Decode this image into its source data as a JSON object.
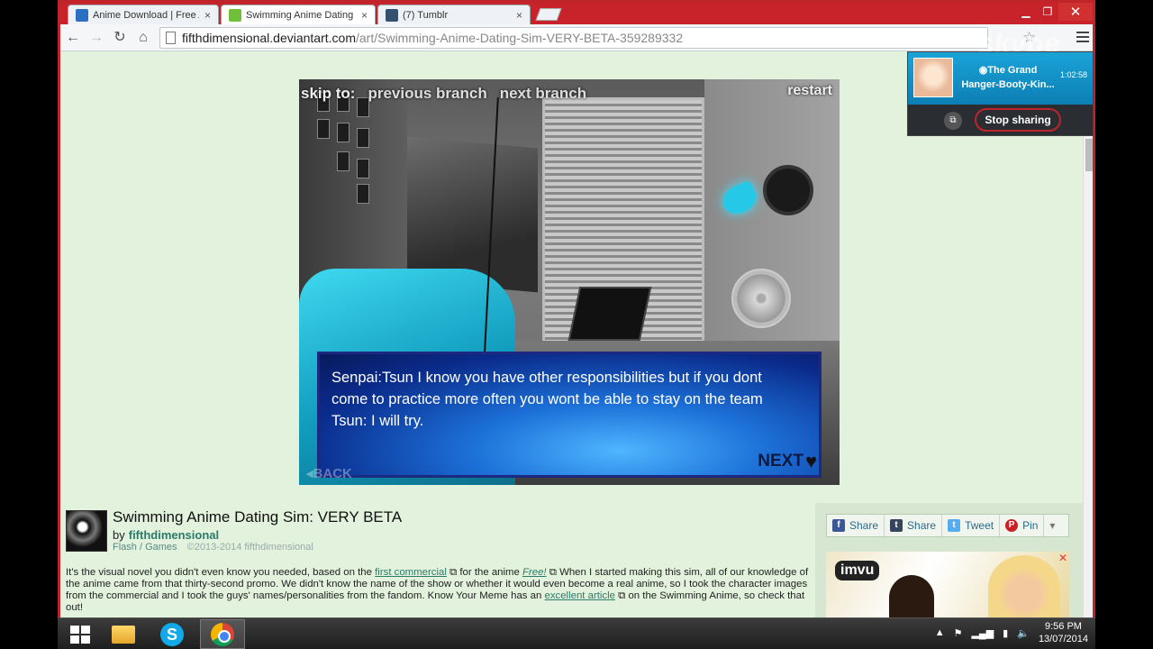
{
  "browser": {
    "tabs": [
      {
        "title": "Anime Download | Free Ar",
        "favicon_color": "#2b6fc2",
        "active": false
      },
      {
        "title": "Swimming Anime Dating",
        "favicon_color": "#6fbf3a",
        "active": true
      },
      {
        "title": "(7) Tumblr",
        "favicon_color": "#34526f",
        "active": false
      }
    ],
    "url_host": "fifthdimensional.deviantart.com",
    "url_path": "/art/Swimming-Anime-Dating-Sim-VERY-BETA-359289332"
  },
  "game": {
    "skip_to": "skip to:",
    "previous_branch": "previous branch",
    "next_branch": "next branch",
    "restart": "restart",
    "dialog_lines": [
      "Senpai:Tsun I know you have other responsibilities but if you dont",
      "come to practice more often you wont be able to stay on the team",
      "Tsun: I will try."
    ],
    "next_label": "NEXT",
    "back_label": "BACK"
  },
  "deviation": {
    "title": "Swimming Anime Dating Sim: VERY BETA",
    "by": "by",
    "author": "fifthdimensional",
    "category_1": "Flash",
    "category_sep": "/",
    "category_2": "Games",
    "copyright": "©2013-2014 fifthdimensional",
    "desc_1": "It's the visual novel you didn't even know you needed, based on the ",
    "link_first_commercial": "first commercial",
    "desc_2": " for the anime ",
    "link_free": "Free!",
    "desc_3": " When I started making this sim, all of our knowledge of the anime came from that thirty-second promo. We didn't know the name of the show or whether it would even become a real anime, so I took the character images from the commercial and I took the guys' names/personalities from the fandom. Know Your Meme has an ",
    "link_article": "excellent article",
    "desc_4": " on the Swimming Anime, so check that out!"
  },
  "share": {
    "facebook": "Share",
    "tumblr": "Share",
    "twitter": "Tweet",
    "pinterest": "Pin"
  },
  "ad": {
    "brand": "imvu"
  },
  "skype": {
    "logo": "skype",
    "contact_name": "The Grand Hanger-Booty-Kin...",
    "call_time": "1:02:58",
    "stop_sharing": "Stop sharing"
  },
  "taskbar": {
    "time": "9:56 PM",
    "date": "13/07/2014"
  }
}
